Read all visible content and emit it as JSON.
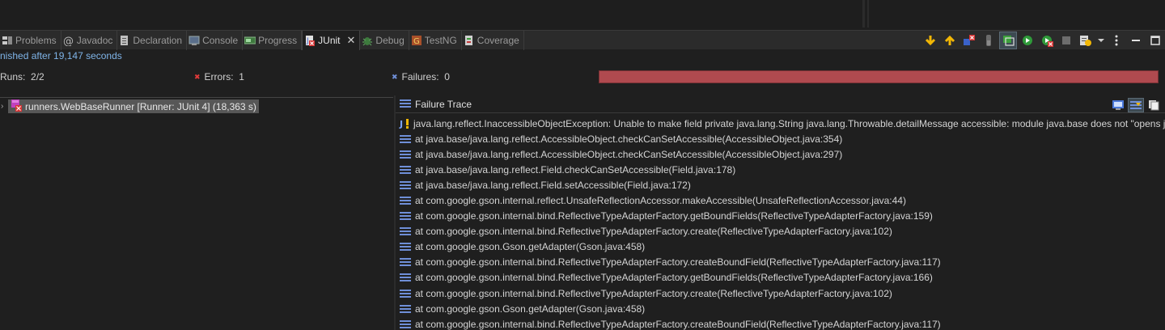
{
  "tabs": [
    {
      "label": "Problems",
      "icon": "problems-icon"
    },
    {
      "label": "Javadoc",
      "icon": "at-icon"
    },
    {
      "label": "Declaration",
      "icon": "declaration-icon"
    },
    {
      "label": "Console",
      "icon": "console-icon"
    },
    {
      "label": "Progress",
      "icon": "progress-icon"
    },
    {
      "label": "JUnit",
      "icon": "junit-icon",
      "active": true
    },
    {
      "label": "Debug",
      "icon": "bug-icon"
    },
    {
      "label": "TestNG",
      "icon": "testng-icon"
    },
    {
      "label": "Coverage",
      "icon": "coverage-icon"
    }
  ],
  "status_text": "nished after 19,147 seconds",
  "counters": {
    "runs_label": "Runs:",
    "runs_value": "2/2",
    "errors_label": "Errors:",
    "errors_value": "1",
    "failures_label": "Failures:",
    "failures_value": "0"
  },
  "progress": {
    "fraction": 1.0,
    "color": "#b04a4f"
  },
  "tree": {
    "root_label": "runners.WebBaseRunner [Runner: JUnit 4] (18,363 s)"
  },
  "trace": {
    "title": "Failure Trace",
    "lines": [
      "java.lang.reflect.InaccessibleObjectException: Unable to make field private java.lang.String java.lang.Throwable.detailMessage accessible: module java.base does not \"opens jav",
      "at java.base/java.lang.reflect.AccessibleObject.checkCanSetAccessible(AccessibleObject.java:354)",
      "at java.base/java.lang.reflect.AccessibleObject.checkCanSetAccessible(AccessibleObject.java:297)",
      "at java.base/java.lang.reflect.Field.checkCanSetAccessible(Field.java:178)",
      "at java.base/java.lang.reflect.Field.setAccessible(Field.java:172)",
      "at com.google.gson.internal.reflect.UnsafeReflectionAccessor.makeAccessible(UnsafeReflectionAccessor.java:44)",
      "at com.google.gson.internal.bind.ReflectiveTypeAdapterFactory.getBoundFields(ReflectiveTypeAdapterFactory.java:159)",
      "at com.google.gson.internal.bind.ReflectiveTypeAdapterFactory.create(ReflectiveTypeAdapterFactory.java:102)",
      "at com.google.gson.Gson.getAdapter(Gson.java:458)",
      "at com.google.gson.internal.bind.ReflectiveTypeAdapterFactory.createBoundField(ReflectiveTypeAdapterFactory.java:117)",
      "at com.google.gson.internal.bind.ReflectiveTypeAdapterFactory.getBoundFields(ReflectiveTypeAdapterFactory.java:166)",
      "at com.google.gson.internal.bind.ReflectiveTypeAdapterFactory.create(ReflectiveTypeAdapterFactory.java:102)",
      "at com.google.gson.Gson.getAdapter(Gson.java:458)",
      "at com.google.gson.internal.bind.ReflectiveTypeAdapterFactory.createBoundField(ReflectiveTypeAdapterFactory.java:117)"
    ]
  },
  "colors": {
    "status_text": "#7fb4e8",
    "stack_icon": "#6f8fd8",
    "error_red": "#e23a3a",
    "arrow_yellow": "#f2b705"
  }
}
